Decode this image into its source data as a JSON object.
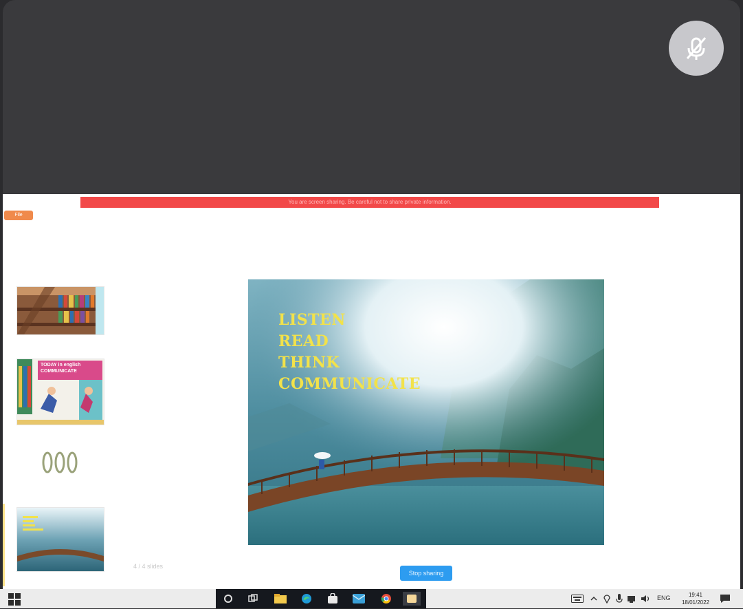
{
  "meeting": {
    "share_banner": "You are screen sharing. Be careful not to share private information.",
    "share_badge": "File",
    "mic_status_icon": "mic-muted-icon",
    "stop_button_label": "Stop sharing",
    "slide_counter": "4 / 4 slides"
  },
  "slides": {
    "main_text": [
      "LISTEN",
      "READ",
      "THINK",
      "COMMUNICATE"
    ],
    "thumb2_caption": [
      "TODAY in english",
      "COMMUNICATE"
    ]
  },
  "taskbar": {
    "language": "ENG",
    "time": "19:41",
    "date": "18/01/2022"
  },
  "colors": {
    "accent_blue": "#2d9cf0",
    "banner_red": "#f24949",
    "slide_text": "#f2e24a"
  }
}
